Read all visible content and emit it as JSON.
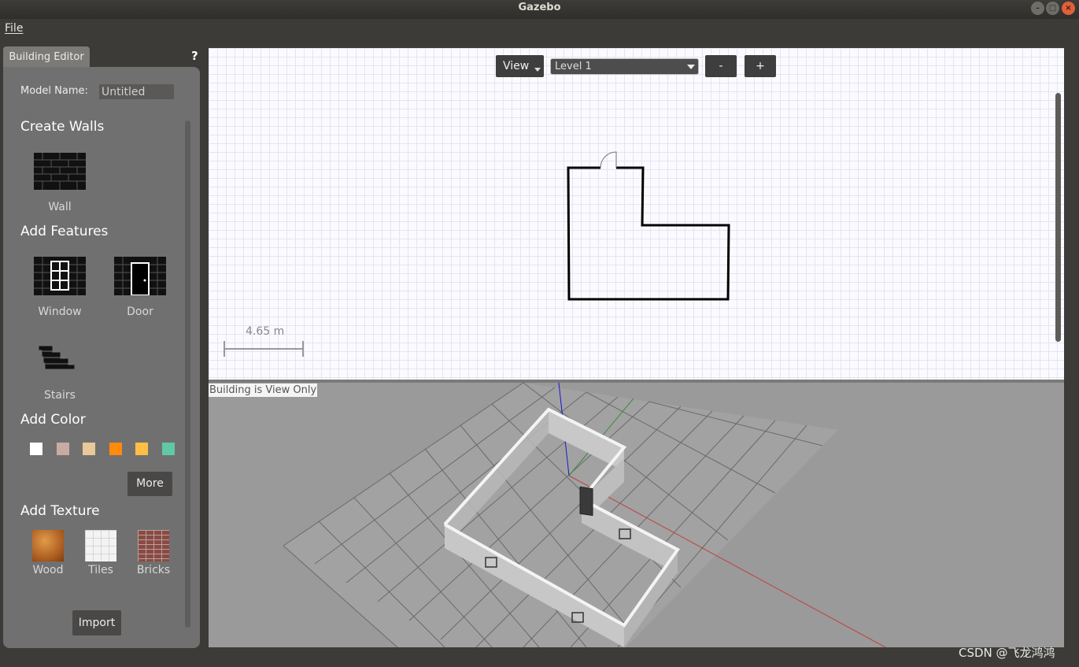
{
  "window": {
    "title": "Gazebo"
  },
  "menu": {
    "file": "File"
  },
  "editor": {
    "tab_label": "Building Editor",
    "help": "?",
    "model_name_label": "Model Name:",
    "model_name_value": "Untitled",
    "create_walls": "Create Walls",
    "wall": "Wall",
    "add_features": "Add Features",
    "window_label": "Window",
    "door_label": "Door",
    "stairs_label": "Stairs",
    "add_color": "Add Color",
    "colors": [
      "#ffffff",
      "#c9aba3",
      "#e9c89a",
      "#ff8a0c",
      "#ffbf45",
      "#5fc9a4"
    ],
    "more": "More",
    "add_texture": "Add Texture",
    "textures": [
      "Wood",
      "Tiles",
      "Bricks"
    ],
    "import": "Import"
  },
  "view2d": {
    "view_button": "View",
    "level": "Level 1",
    "minus": "-",
    "plus": "+",
    "scale_label": "4.65 m"
  },
  "view3d": {
    "status": "Building is View Only"
  },
  "watermark": "CSDN @飞龙鸿鸿"
}
